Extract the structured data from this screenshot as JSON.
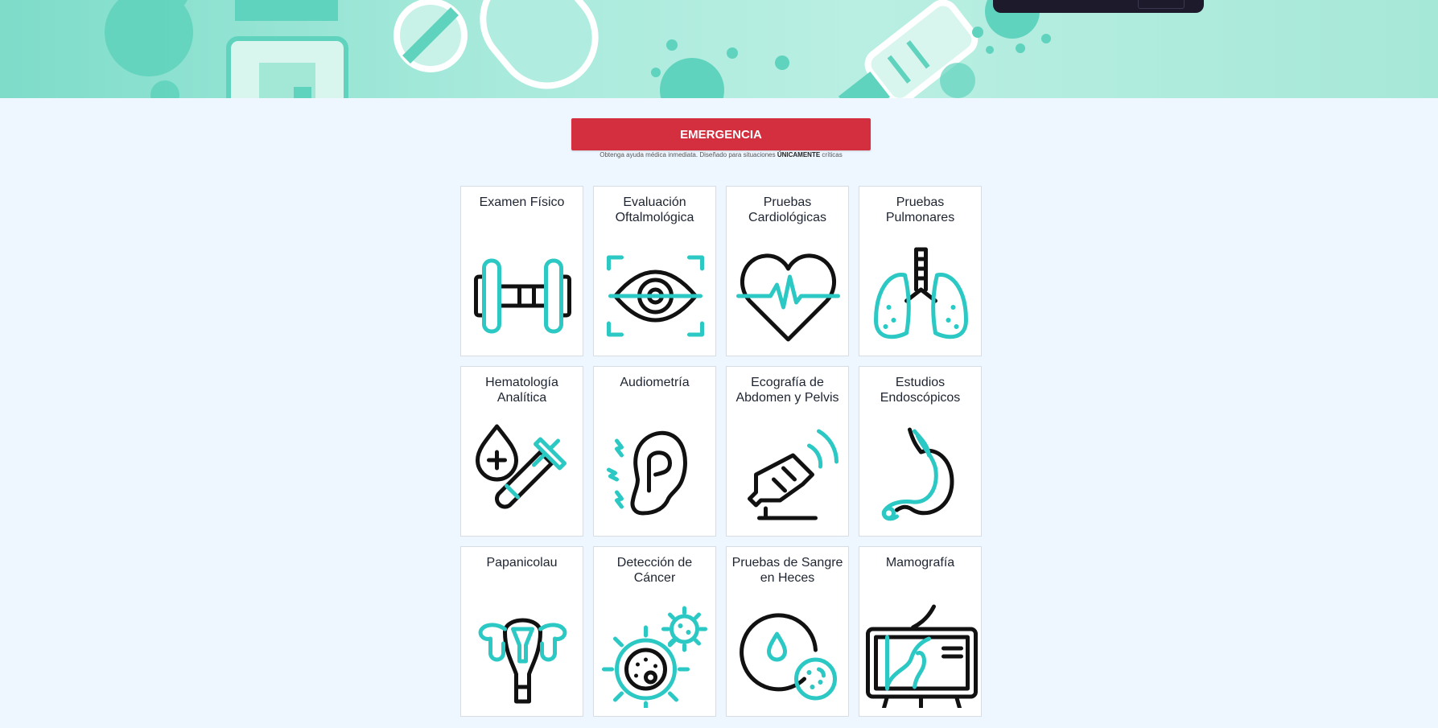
{
  "emergency": {
    "button_label": "EMERGENCIA",
    "note_prefix": "Obtenga ayuda médica inmediata. Diseñado para situaciones ",
    "note_emphasis": "ÚNICAMENTE",
    "note_suffix": " críticas"
  },
  "colors": {
    "emergency": "#d32f3f",
    "icon_accent": "#2bc8c4",
    "icon_ink": "#111111",
    "background": "#eef6ff"
  },
  "services": [
    {
      "title": "Examen Físico",
      "icon": "dumbbell-icon"
    },
    {
      "title": "Evaluación Oftalmológica",
      "icon": "eye-scan-icon"
    },
    {
      "title": "Pruebas Cardiológicas",
      "icon": "heart-pulse-icon"
    },
    {
      "title": "Pruebas Pulmonares",
      "icon": "lungs-icon"
    },
    {
      "title": "Hematología Analítica",
      "icon": "blood-test-tube-icon"
    },
    {
      "title": "Audiometría",
      "icon": "ear-icon"
    },
    {
      "title": "Ecografía de Abdomen y Pelvis",
      "icon": "ultrasound-probe-icon"
    },
    {
      "title": "Estudios Endoscópicos",
      "icon": "stomach-icon"
    },
    {
      "title": "Papanicolau",
      "icon": "uterus-icon"
    },
    {
      "title": "Detección de Cáncer",
      "icon": "cancer-cell-icon"
    },
    {
      "title": "Pruebas de Sangre en Heces",
      "icon": "stool-sample-icon"
    },
    {
      "title": "Mamografía",
      "icon": "mammography-screen-icon"
    }
  ]
}
